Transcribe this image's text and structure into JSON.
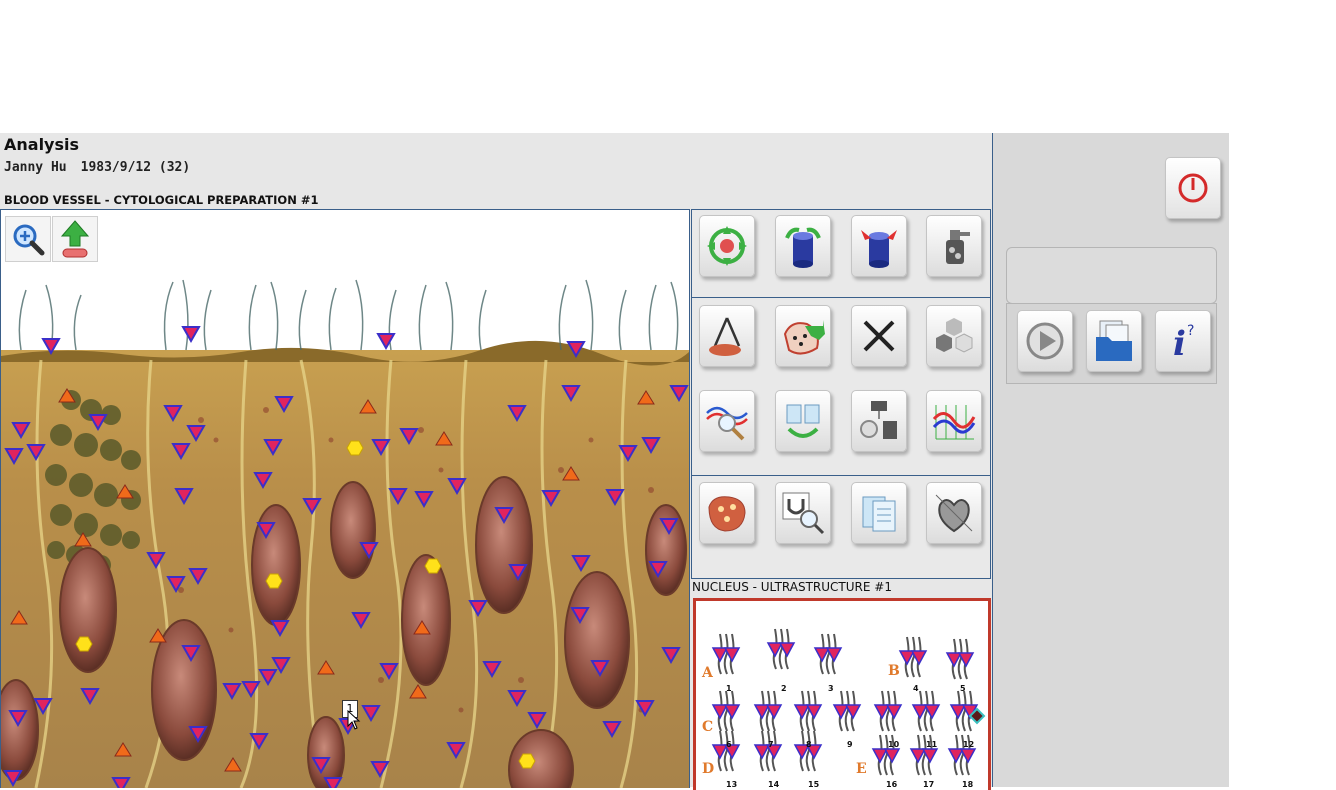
{
  "app": {
    "title": "Analysis",
    "patient_name": "Janny  Hu",
    "patient_dob_age": "1983/9/12 (32)"
  },
  "viewer": {
    "section_title": "BLOOD VESSEL - CYTOLOGICAL PREPARATION #1",
    "tools": [
      {
        "name": "zoom-in-icon"
      },
      {
        "name": "upload-arrow-icon"
      }
    ],
    "cursor_label": "1"
  },
  "tool_panel": {
    "rows": [
      [
        "target-compass-icon",
        "cylinder-arrows-out-icon",
        "cylinder-arrows-in-icon",
        "spray-bottle-icon"
      ],
      [
        "caliper-measure-icon",
        "cell-pointer-icon",
        "close-x-icon",
        "hexagons-icon"
      ],
      [
        "search-graph-icon",
        "documents-cycle-icon",
        "flow-chart-icon",
        "waveform-chart-icon"
      ],
      [
        "tissue-sample-icon",
        "magnet-search-icon",
        "clipboard-icon",
        "heart-organ-icon"
      ]
    ]
  },
  "nucleus": {
    "title": "NUCLEUS - ULTRASTRUCTURE #1",
    "groups": [
      "A",
      "B",
      "C",
      "D",
      "E"
    ],
    "numbers": [
      "1",
      "2",
      "3",
      "4",
      "5",
      "6",
      "7",
      "8",
      "9",
      "10",
      "11",
      "12",
      "13",
      "14",
      "15",
      "16",
      "17",
      "18"
    ]
  },
  "side": {
    "power_icon": "power-icon",
    "controls": [
      "play-icon",
      "folder-documents-icon",
      "info-icon"
    ]
  },
  "colors": {
    "frame_border": "#3a5f8a",
    "karyo_border": "#c0392b",
    "marker_blue": "#3b2fc9",
    "marker_red": "#e0245e",
    "marker_orange": "#f06a1a",
    "marker_yellow": "#ffe11a"
  }
}
